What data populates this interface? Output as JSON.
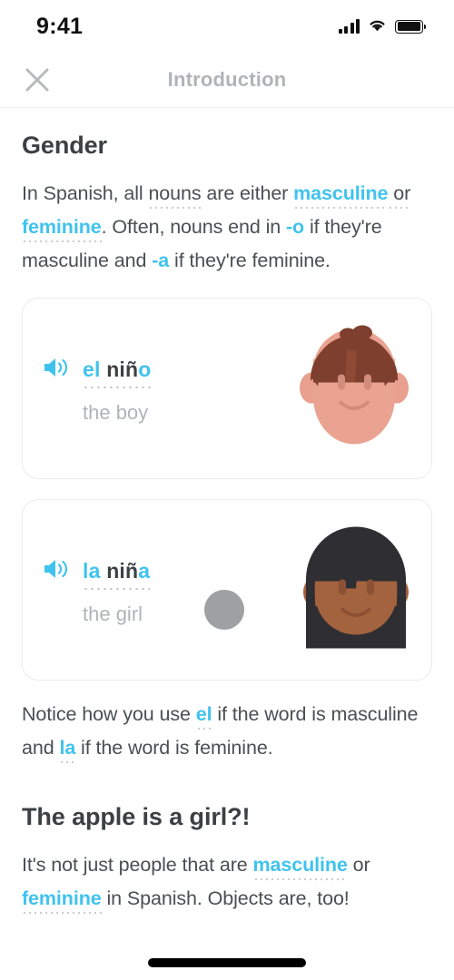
{
  "status_bar": {
    "time": "9:41",
    "signal_icon": "cellular-signal-icon",
    "wifi_icon": "wifi-icon",
    "battery_icon": "battery-full-icon"
  },
  "nav": {
    "close_icon": "close-x-icon",
    "title": "Introduction"
  },
  "colors": {
    "accent_blue": "#3fc3ee",
    "text_dark": "#4b4f52",
    "text_muted": "#b0b4b8",
    "card_border": "#ececee",
    "touch_dot": "#9fa0a2"
  },
  "sections": [
    {
      "heading": "Gender",
      "paragraph_plain": "In Spanish, all nouns are either masculine or feminine. Often, nouns end in -o if they're masculine and -a if they're feminine.",
      "parts": {
        "p1": "In Spanish, all ",
        "nouns": "nouns",
        "p2": " are either ",
        "masculine": "masculine",
        "p3": " or ",
        "feminine": "feminine",
        "p4": ". Often, nouns end in ",
        "o_ending": "-o",
        "p5": " if they're masculine and ",
        "a_ending": "-a",
        "p6": " if they're feminine."
      }
    }
  ],
  "cards": [
    {
      "speaker_icon": "speaker-audio-icon",
      "word_article": "el",
      "word_stem": "niñ",
      "word_ending": "o",
      "word_full": "el niño",
      "translation": "the boy",
      "avatar": "boy-face-avatar"
    },
    {
      "speaker_icon": "speaker-audio-icon",
      "word_article": "la",
      "word_stem": "niñ",
      "word_ending": "a",
      "word_full": "la niña",
      "translation": "the girl",
      "avatar": "girl-face-avatar"
    }
  ],
  "notice": {
    "p1": "Notice how you use ",
    "el": "el",
    "p2": " if the word is masculine and ",
    "la": "la",
    "p3": " if the word is feminine.",
    "plain": "Notice how you use el if the word is masculine and la if the word is feminine."
  },
  "apple_section": {
    "heading": "The apple is a girl?!",
    "p1": "It's not just people that are ",
    "masculine": "masculine",
    "p2": " or ",
    "feminine": "feminine",
    "p3": " in Spanish. Objects are, too!",
    "plain": "It's not just people that are masculine or feminine in Spanish. Objects are, too!"
  },
  "home_indicator": "home-indicator-bar"
}
